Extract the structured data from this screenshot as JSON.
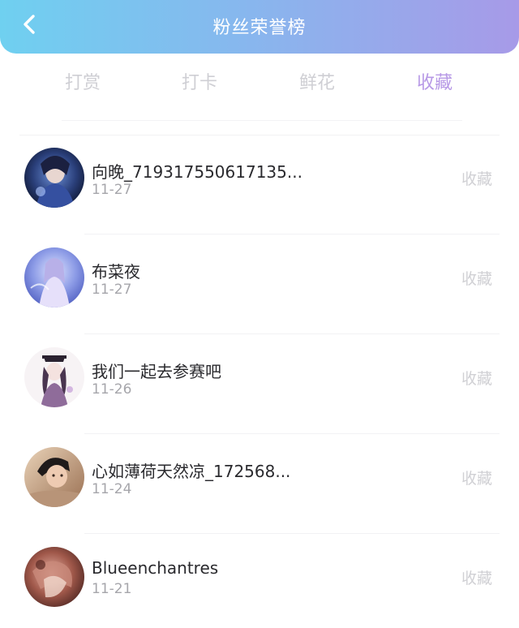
{
  "header": {
    "title": "粉丝荣誉榜",
    "back_icon": "chevron-left-icon"
  },
  "tabs": [
    {
      "label": "打赏",
      "active": false
    },
    {
      "label": "打卡",
      "active": false
    },
    {
      "label": "鲜花",
      "active": false
    },
    {
      "label": "收藏",
      "active": true
    }
  ],
  "colors": {
    "accent": "#b799e6",
    "header_start": "#6fd0f0",
    "header_end": "#a79ae8"
  },
  "fans": [
    {
      "name": "向晚_719317550617135...",
      "date": "11-27",
      "action": "收藏"
    },
    {
      "name": "布菜夜",
      "date": "11-27",
      "action": "收藏"
    },
    {
      "name": "我们一起去参赛吧",
      "date": "11-26",
      "action": "收藏"
    },
    {
      "name": "心如薄荷天然凉_172568...",
      "date": "11-24",
      "action": "收藏"
    },
    {
      "name": "Blueenchantres",
      "date": "11-21",
      "action": "收藏"
    }
  ]
}
